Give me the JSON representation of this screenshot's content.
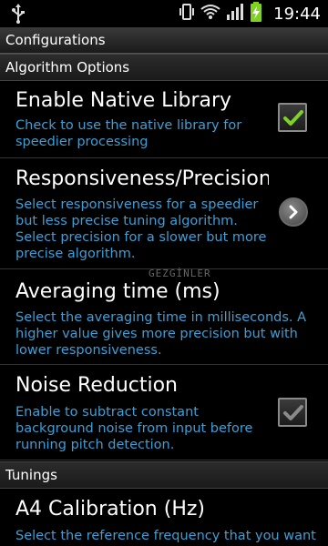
{
  "status_bar": {
    "time": "19:44",
    "icons": [
      "usb-icon",
      "vibrate-icon",
      "wifi-icon",
      "signal-icon",
      "battery-icon"
    ]
  },
  "title": "Configurations",
  "sections": {
    "algorithm": "Algorithm Options",
    "tunings": "Tunings"
  },
  "prefs": {
    "native": {
      "title": "Enable Native Library",
      "summary": "Check to use the native library for speedier processing",
      "checked": true
    },
    "responsiveness": {
      "title": "Responsiveness/Precision",
      "summary": "Select responsiveness for a speedier but less precise tuning algorithm. Select precision for a slower but more precise algorithm."
    },
    "averaging": {
      "title": "Averaging time (ms)",
      "summary": "Select the averaging time in milliseconds. A higher value gives more precision but with lower responsiveness."
    },
    "noise": {
      "title": "Noise Reduction",
      "summary": "Enable to subtract constant background noise from input before running pitch detection.",
      "checked": true
    },
    "a4": {
      "title": "A4 Calibration (Hz)",
      "summary": "Select the reference frequency that you want"
    }
  },
  "watermark": "GEZGİNLER",
  "colors": {
    "summary": "#3d9fd6",
    "check_active": "#7ed321",
    "check_disabled": "#8a8a8a"
  }
}
